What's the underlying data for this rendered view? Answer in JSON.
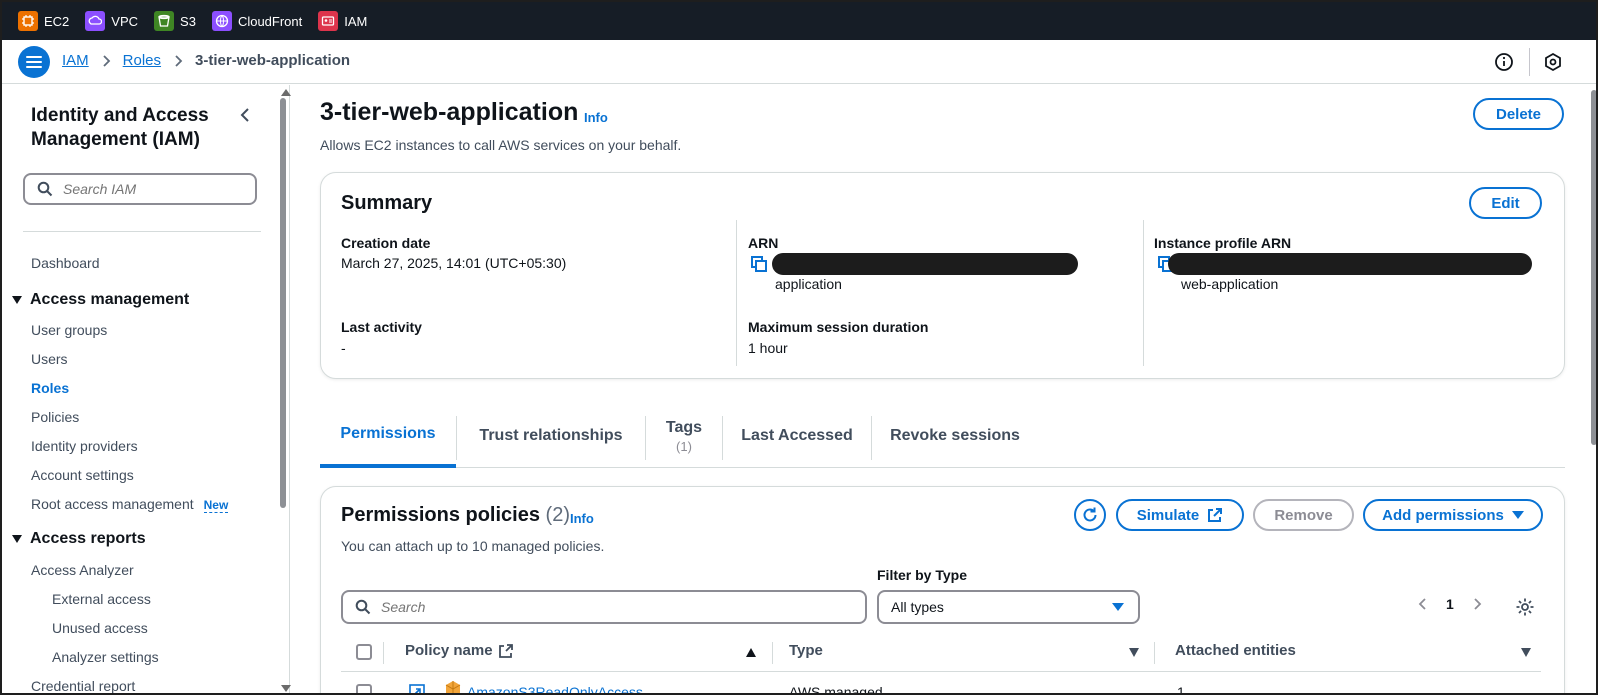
{
  "service_bar": {
    "items": [
      {
        "label": "EC2",
        "icon": "ec2-icon",
        "color": "#ed7100"
      },
      {
        "label": "VPC",
        "icon": "vpc-icon",
        "color": "#8c4fff"
      },
      {
        "label": "S3",
        "icon": "s3-icon",
        "color": "#3f8624"
      },
      {
        "label": "CloudFront",
        "icon": "cloudfront-icon",
        "color": "#8c4fff"
      },
      {
        "label": "IAM",
        "icon": "iam-icon",
        "color": "#dd344c"
      }
    ]
  },
  "breadcrumb": {
    "items": [
      "IAM",
      "Roles"
    ],
    "current": "3-tier-web-application"
  },
  "sidebar": {
    "title": "Identity and Access Management (IAM)",
    "search_placeholder": "Search IAM",
    "dashboard": "Dashboard",
    "access_management": {
      "heading": "Access management",
      "items": [
        "User groups",
        "Users",
        "Roles",
        "Policies",
        "Identity providers",
        "Account settings",
        "Root access management"
      ],
      "new_badge": "New"
    },
    "access_reports": {
      "heading": "Access reports",
      "items": [
        "Access Analyzer"
      ],
      "sub_items": [
        "External access",
        "Unused access",
        "Analyzer settings"
      ],
      "cut_off": "Credential report"
    },
    "active_item": "Roles"
  },
  "header": {
    "title": "3-tier-web-application",
    "info": "Info",
    "description": "Allows EC2 instances to call AWS services on your behalf.",
    "delete_label": "Delete"
  },
  "summary": {
    "heading": "Summary",
    "edit_label": "Edit",
    "creation_date_label": "Creation date",
    "creation_date": "March 27, 2025, 14:01 (UTC+05:30)",
    "last_activity_label": "Last activity",
    "last_activity": "-",
    "arn_label": "ARN",
    "arn_visible_tail": "application",
    "max_session_label": "Maximum session duration",
    "max_session": "1 hour",
    "instance_profile_label": "Instance profile ARN",
    "instance_profile_visible_tail": "web-application"
  },
  "tabs": [
    {
      "label": "Permissions",
      "active": true
    },
    {
      "label": "Trust relationships"
    },
    {
      "label": "Tags",
      "count": "(1)"
    },
    {
      "label": "Last Accessed"
    },
    {
      "label": "Revoke sessions"
    }
  ],
  "permissions": {
    "heading": "Permissions policies",
    "count": "(2)",
    "info": "Info",
    "description": "You can attach up to 10 managed policies.",
    "simulate_label": "Simulate",
    "remove_label": "Remove",
    "add_label": "Add permissions",
    "filter_label": "Filter by Type",
    "search_placeholder": "Search",
    "filter_value": "All types",
    "page": "1",
    "columns": {
      "policy_name": "Policy name",
      "type": "Type",
      "attached": "Attached entities"
    },
    "rows": [
      {
        "name": "AmazonS3ReadOnlyAccess",
        "type": "AWS managed",
        "attached": "1"
      }
    ]
  }
}
